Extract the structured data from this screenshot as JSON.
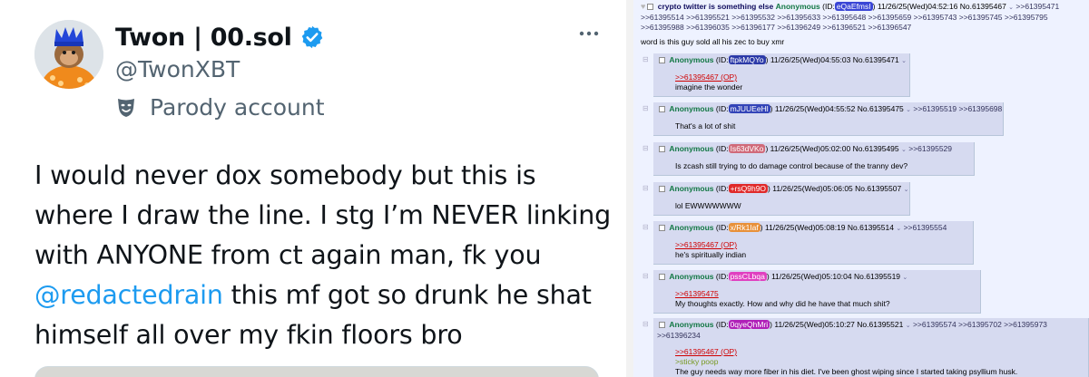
{
  "tweet": {
    "display_name": "Twon | 00.sol",
    "handle": "@TwonXBT",
    "parody_label": "Parody account",
    "text": {
      "part1": "I would never dox somebody but this is where I draw the line. I stg I’m NEVER linking with ANYONE from ct again man, fk you",
      "mention": "@redactedrain",
      "part2": "this mf got so drunk he shat himself all over my fkin floors bro"
    },
    "verified_color": "#1d9bf0"
  },
  "thread": {
    "op": {
      "subject": "crypto twitter is something else",
      "name": "Anonymous",
      "id_prefix": "(ID:",
      "id": "eQaEfmsI",
      "id_color": "#3a46d6",
      "id_suffix": ")",
      "datetime": "11/26/25(Wed)04:52:16",
      "postno": "No.61395467",
      "backlinks_line1": ">>61395471",
      "backlinks_line2": ">>61395514 >>61395521 >>61395532 >>61395633 >>61395648 >>61395659 >>61395743 >>61395745 >>61395795",
      "backlinks_line3": ">>61395988 >>61396035 >>61396177 >>61396249 >>61396521 >>61396547",
      "body": "word is this guy sold all his zec to buy xmr"
    },
    "replies": [
      {
        "name": "Anonymous",
        "id_prefix": "(ID:",
        "id": "ftpkMQYo",
        "id_color": "#2c3aa8",
        "id_suffix": ")",
        "datetime": "11/26/25(Wed)04:55:03",
        "postno": "No.61395471",
        "backlinks": "",
        "backlinks2": "",
        "quote": ">>61395467 (OP)",
        "greentext": "",
        "text": "imagine the wonder"
      },
      {
        "name": "Anonymous",
        "id_prefix": "(ID:",
        "id": "mJUUEeHl",
        "id_color": "#3344b8",
        "id_suffix": ")",
        "datetime": "11/26/25(Wed)04:55:52",
        "postno": "No.61395475",
        "backlinks": ">>61395519 >>61395698",
        "backlinks2": "",
        "quote": "",
        "greentext": "",
        "text": "That's a lot of shit"
      },
      {
        "name": "Anonymous",
        "id_prefix": "(ID:",
        "id": "Is63dVKo",
        "id_color": "#d06a7a",
        "id_suffix": ")",
        "datetime": "11/26/25(Wed)05:02:00",
        "postno": "No.61395495",
        "backlinks": ">>61395529",
        "backlinks2": "",
        "quote": "",
        "greentext": "",
        "text": "Is zcash still trying to do damage control because of the tranny dev?"
      },
      {
        "name": "Anonymous",
        "id_prefix": "(ID:",
        "id": "+rsQ9h9O",
        "id_color": "#e02a2a",
        "id_suffix": ")",
        "datetime": "11/26/25(Wed)05:06:05",
        "postno": "No.61395507",
        "backlinks": "",
        "backlinks2": "",
        "quote": "",
        "greentext": "",
        "text": "lol EWWWWWWW"
      },
      {
        "name": "Anonymous",
        "id_prefix": "(ID:",
        "id": "x/Rk1Iaf",
        "id_color": "#e8913a",
        "id_suffix": ")",
        "datetime": "11/26/25(Wed)05:08:19",
        "postno": "No.61395514",
        "backlinks": ">>61395554",
        "backlinks2": "",
        "quote": ">>61395467 (OP)",
        "greentext": "",
        "text": "he's spiritually indian"
      },
      {
        "name": "Anonymous",
        "id_prefix": "(ID:",
        "id": "pssCLbqa",
        "id_color": "#e040c0",
        "id_suffix": ")",
        "datetime": "11/26/25(Wed)05:10:04",
        "postno": "No.61395519",
        "backlinks": "",
        "backlinks2": "",
        "quote": ">>61395475",
        "greentext": "",
        "text": "My thoughts exactly. How and why did he have that much shit?"
      },
      {
        "name": "Anonymous",
        "id_prefix": "(ID:",
        "id": "0qyeQhMri",
        "id_color": "#b020b8",
        "id_suffix": ")",
        "datetime": "11/26/25(Wed)05:10:27",
        "postno": "No.61395521",
        "backlinks": ">>61395574 >>61395702 >>61395973",
        "backlinks2": ">>61396234",
        "quote": ">>61395467 (OP)",
        "greentext": ">sticky poop",
        "text": "The guy needs way more fiber in his diet. I've been ghost wiping since I started taking psyllium husk."
      }
    ]
  }
}
